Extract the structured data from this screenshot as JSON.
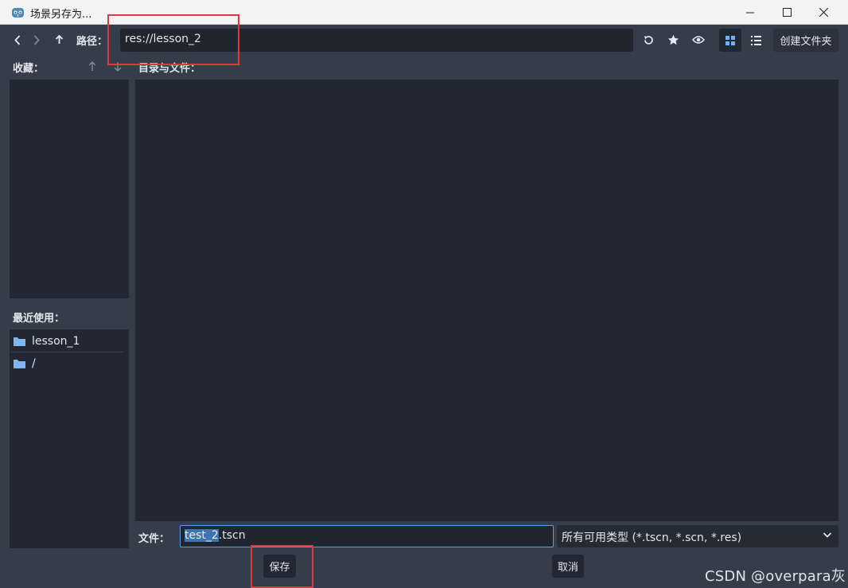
{
  "window": {
    "title": "场景另存为...",
    "app_icon": "godot-icon"
  },
  "toolbar": {
    "back_icon": "chevron-left-icon",
    "forward_icon": "chevron-right-icon",
    "up_icon": "arrow-up-icon",
    "path_label": "路径：",
    "path_value": "res://lesson_2",
    "refresh_icon": "refresh-icon",
    "favorite_icon": "star-icon",
    "hidden_icon": "eye-icon",
    "grid_view_icon": "grid-view-icon",
    "list_view_icon": "list-view-icon",
    "create_folder": "创建文件夹"
  },
  "favorites": {
    "label": "收藏：",
    "move_up_icon": "arrow-up-icon",
    "move_down_icon": "arrow-down-icon"
  },
  "files": {
    "label": "目录与文件："
  },
  "recent": {
    "label": "最近使用：",
    "items": [
      {
        "name": "lesson_1",
        "icon": "folder-icon"
      },
      {
        "name": "/",
        "icon": "folder-icon"
      }
    ]
  },
  "file_row": {
    "label": "文件：",
    "name_selected": "test_2",
    "name_rest": ".tscn",
    "filter": "所有可用类型 (*.tscn, *.scn, *.res)"
  },
  "buttons": {
    "save": "保存",
    "cancel": "取消"
  },
  "watermark": "CSDN @overpara灰",
  "colors": {
    "dialog_bg": "#363d4a",
    "panel_bg": "#222833",
    "accent": "#5a9fe8",
    "annotation_red": "#e0393d"
  }
}
